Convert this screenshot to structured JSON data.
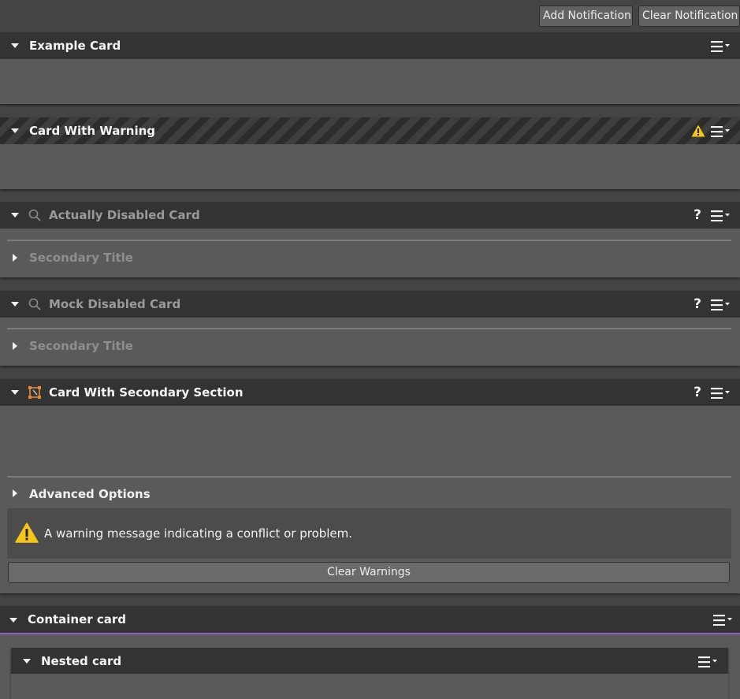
{
  "toolbar": {
    "add_notification": "Add Notification",
    "clear_notification": "Clear Notification"
  },
  "cards": {
    "example": {
      "title": "Example Card"
    },
    "warning": {
      "title": "Card With Warning"
    },
    "actually_disabled": {
      "title": "Actually Disabled Card",
      "secondary_title": "Secondary Title"
    },
    "mock_disabled": {
      "title": "Mock Disabled Card",
      "secondary_title": "Secondary Title"
    },
    "secondary_section": {
      "title": "Card With Secondary Section",
      "advanced_options": "Advanced Options",
      "warning_message": "A warning message indicating a conflict or problem.",
      "clear_warnings": "Clear Warnings"
    },
    "container": {
      "title": "Container card"
    },
    "nested": {
      "title": "Nested card"
    }
  },
  "icons": {
    "help": "?",
    "warning_color": "#f5c518",
    "container_accent": "#8a62c8"
  }
}
